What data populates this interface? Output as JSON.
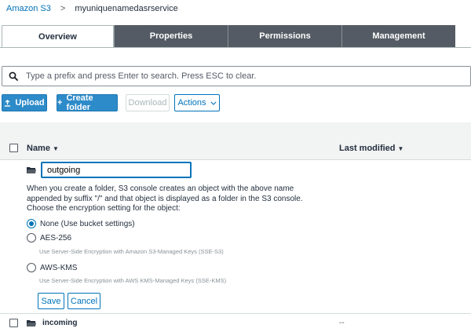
{
  "breadcrumb": {
    "root": "Amazon S3",
    "separator": ">",
    "bucket": "myuniquenamedasrservice"
  },
  "tabs": [
    {
      "label": "Overview",
      "active": true
    },
    {
      "label": "Properties",
      "active": false
    },
    {
      "label": "Permissions",
      "active": false
    },
    {
      "label": "Management",
      "active": false
    }
  ],
  "search": {
    "placeholder": "Type a prefix and press Enter to search. Press ESC to clear.",
    "value": ""
  },
  "toolbar": {
    "upload_label": "Upload",
    "create_folder_label": "Create folder",
    "download_label": "Download",
    "actions_label": "Actions"
  },
  "table": {
    "columns": {
      "name": "Name",
      "last_modified": "Last modified"
    },
    "new_folder": {
      "input_value": "outgoing",
      "info_text": "When you create a folder, S3 console creates an object with the above name appended by suffix \"/\" and that object is displayed as a folder in the S3 console. Choose the encryption setting for the object:",
      "options": [
        {
          "label": "None (Use bucket settings)",
          "description": "",
          "selected": true
        },
        {
          "label": "AES-256",
          "description": "Use Server-Side Encryption with Amazon S3-Managed Keys (SSE-S3)",
          "selected": false
        },
        {
          "label": "AWS-KMS",
          "description": "Use Server-Side Encryption with AWS KMS-Managed Keys (SSE-KMS)",
          "selected": false
        }
      ],
      "save_label": "Save",
      "cancel_label": "Cancel"
    },
    "rows": [
      {
        "name": "incoming",
        "last_modified": "--"
      }
    ]
  },
  "colors": {
    "accent": "#0073bb",
    "primary_button": "#2e8bc9",
    "tab_inactive": "#545b64",
    "header_bg": "#f2f3f3"
  },
  "icons": {
    "search": "search-icon",
    "upload": "upload-icon",
    "plus": "plus-icon",
    "folder": "folder-icon",
    "chevron": "chevron-down-icon"
  }
}
